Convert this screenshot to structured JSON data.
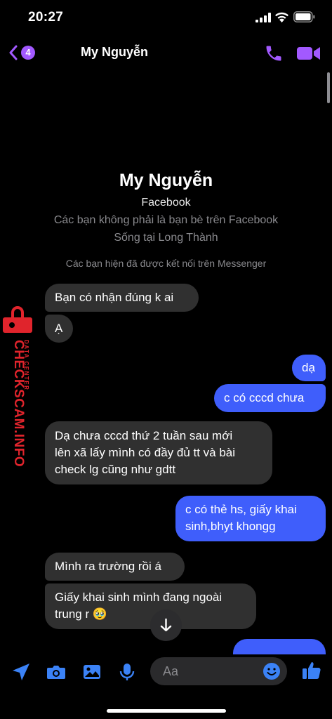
{
  "status_bar": {
    "time": "20:27"
  },
  "header": {
    "unread_count": "4",
    "title": "My Nguyễn"
  },
  "profile": {
    "name": "My Nguyễn",
    "platform": "Facebook",
    "friend_note": "Các bạn không phải là bạn bè trên Facebook",
    "location": "Sống tại Long Thành",
    "connected_note": "Các bạn hiện đã được kết nối trên Messenger"
  },
  "messages": [
    {
      "direction": "incoming",
      "text": "Bạn có nhận đúng k ai"
    },
    {
      "direction": "incoming",
      "text": "Ạ"
    },
    {
      "direction": "outgoing",
      "text": "dạ"
    },
    {
      "direction": "outgoing",
      "text": "c có cccd chưa"
    },
    {
      "direction": "incoming",
      "line1": "Dạ chưa cccd thứ 2 tuần sau mới",
      "line2": "lên xã lấy mình có đầy đủ tt và bài",
      "line3": "check lg cũng như gdtt"
    },
    {
      "direction": "outgoing",
      "line1": "c có thẻ hs, giấy khai",
      "line2": "sinh,bhyt khongg"
    },
    {
      "direction": "incoming",
      "text": "Mình ra trường rồi á"
    },
    {
      "direction": "incoming",
      "line1": "Giấy khai sinh mình đang ngoài",
      "line2": "trung r 🥹"
    }
  ],
  "watermark": {
    "main": "CHECKSCAM.INFO",
    "sub": "DATA CENTER"
  },
  "composer": {
    "placeholder": "Aa"
  },
  "colors": {
    "accent": "#a259ff",
    "outgoing_bubble": "#3f5efb",
    "incoming_bubble": "#303030",
    "composer_icon": "#3b82f6",
    "watermark": "#e0242c"
  },
  "icons": [
    "signal-icon",
    "wifi-icon",
    "battery-icon",
    "back-chevron-icon",
    "phone-icon",
    "video-icon",
    "lock-icon",
    "arrow-down-icon",
    "location-arrow-icon",
    "camera-icon",
    "image-icon",
    "microphone-icon",
    "emoji-icon",
    "thumbs-up-icon"
  ]
}
